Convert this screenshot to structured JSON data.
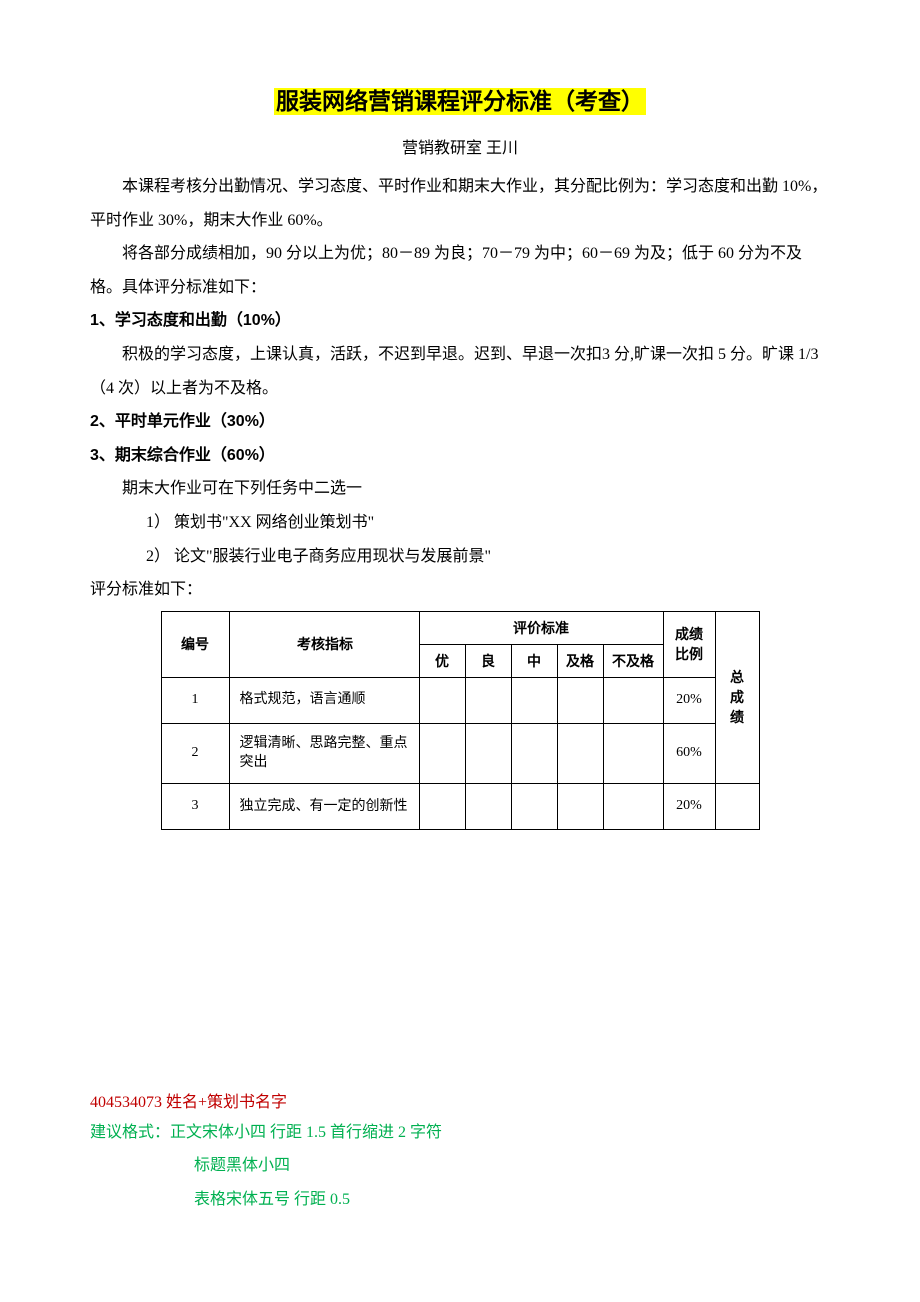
{
  "title": "服装网络营销课程评分标准（考查）",
  "author": "营销教研室 王川",
  "p1": "本课程考核分出勤情况、学习态度、平时作业和期末大作业，其分配比例为：学习态度和出勤 10%，平时作业 30%，期末大作业 60%。",
  "p2": "将各部分成绩相加，90 分以上为优；80－89 为良；70－79 为中；60－69 为及；低于 60 分为不及格。具体评分标准如下：",
  "h1": "1、学习态度和出勤（10%）",
  "p3": "积极的学习态度，上课认真，活跃，不迟到早退。迟到、早退一次扣3 分,旷课一次扣 5 分。旷课 1/3（4 次）以上者为不及格。",
  "h2": "2、平时单元作业（30%）",
  "h3": "3、期末综合作业（60%）",
  "p4": "期末大作业可在下列任务中二选一",
  "opt1": "1） 策划书\"XX 网络创业策划书\"",
  "opt2": "2） 论文\"服装行业电子商务应用现状与发展前景\"",
  "tableLabel": "评分标准如下：",
  "table": {
    "headers": {
      "num": "编号",
      "metric": "考核指标",
      "standard": "评价标准",
      "ratio": "成绩比例",
      "total": "总成绩",
      "grades": [
        "优",
        "良",
        "中",
        "及格",
        "不及格"
      ]
    },
    "rows": [
      {
        "num": "1",
        "metric": "格式规范，语言通顺",
        "ratio": "20%"
      },
      {
        "num": "2",
        "metric": "逻辑清晰、思路完整、重点突出",
        "ratio": "60%"
      },
      {
        "num": "3",
        "metric": "独立完成、有一定的创新性",
        "ratio": "20%"
      }
    ]
  },
  "footer": {
    "red": "404534073 姓名+策划书名字",
    "g1": "建议格式：正文宋体小四 行距 1.5 首行缩进 2 字符",
    "g2": "标题黑体小四",
    "g3": "表格宋体五号 行距 0.5"
  }
}
